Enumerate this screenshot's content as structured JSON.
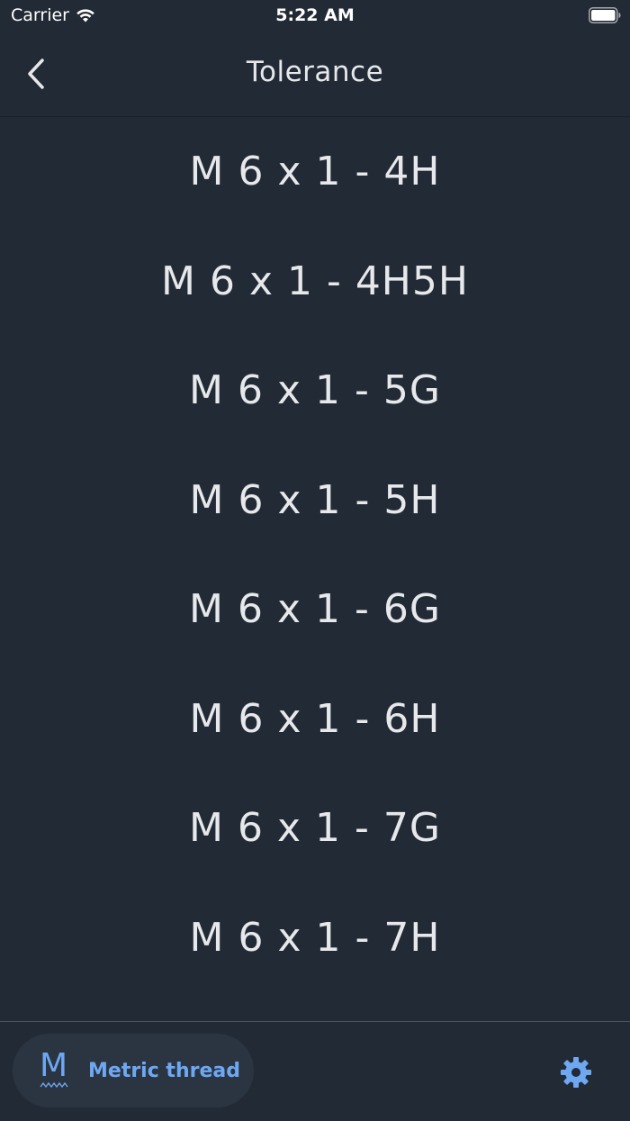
{
  "status_bar": {
    "carrier": "Carrier",
    "time": "5:22 AM"
  },
  "nav": {
    "title": "Tolerance"
  },
  "items": [
    {
      "label": "M 6 x 1 - 4H"
    },
    {
      "label": "M 6 x 1 - 4H5H"
    },
    {
      "label": "M 6 x 1 - 5G"
    },
    {
      "label": "M 6 x 1 - 5H"
    },
    {
      "label": "M 6 x 1 - 6G"
    },
    {
      "label": "M 6 x 1 - 6H"
    },
    {
      "label": "M 6 x 1 - 7G"
    },
    {
      "label": "M 6 x 1 - 7H"
    }
  ],
  "tab_bar": {
    "tab_label": "Metric thread",
    "tab_icon_letter": "M"
  },
  "colors": {
    "background": "#222a35",
    "accent": "#6ea8f2",
    "pill": "#2b3542",
    "text": "#e6e8eb"
  },
  "icons": {
    "back": "chevron-left-icon",
    "settings": "gear-icon",
    "wifi": "wifi-icon",
    "battery": "battery-icon",
    "metric": "metric-thread-icon"
  }
}
